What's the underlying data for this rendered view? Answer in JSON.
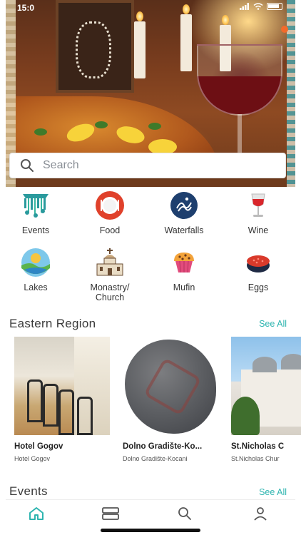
{
  "status_bar": {
    "time": "15:0"
  },
  "search": {
    "placeholder": "Search"
  },
  "categories": [
    {
      "label": "Events",
      "icon": "events-icon"
    },
    {
      "label": "Food",
      "icon": "food-plate-icon"
    },
    {
      "label": "Waterfalls",
      "icon": "waterfall-icon"
    },
    {
      "label": "Wine",
      "icon": "wine-glass-icon"
    },
    {
      "label": "Lakes",
      "icon": "lake-icon"
    },
    {
      "label": "Monastry/\nChurch",
      "icon": "church-icon"
    },
    {
      "label": "Mufin",
      "icon": "muffin-icon"
    },
    {
      "label": "Eggs",
      "icon": "eggs-icon"
    }
  ],
  "eastern_region": {
    "title": "Eastern Region",
    "see_all": "See All",
    "cards": [
      {
        "title": "Hotel Gogov",
        "subtitle": "Hotel Gogov"
      },
      {
        "title": "Dolno Gradište-Ko...",
        "subtitle": "Dolno Gradište-Kocani"
      },
      {
        "title": "St.Nicholas C",
        "subtitle": "St.Nicholas Chur"
      }
    ]
  },
  "events": {
    "title": "Events",
    "see_all": "See All"
  },
  "bottom_nav": [
    "home-icon",
    "list-icon",
    "search-icon",
    "profile-icon"
  ],
  "colors": {
    "accent": "#2fb5b0",
    "nav_active": "#2fb5b0"
  }
}
